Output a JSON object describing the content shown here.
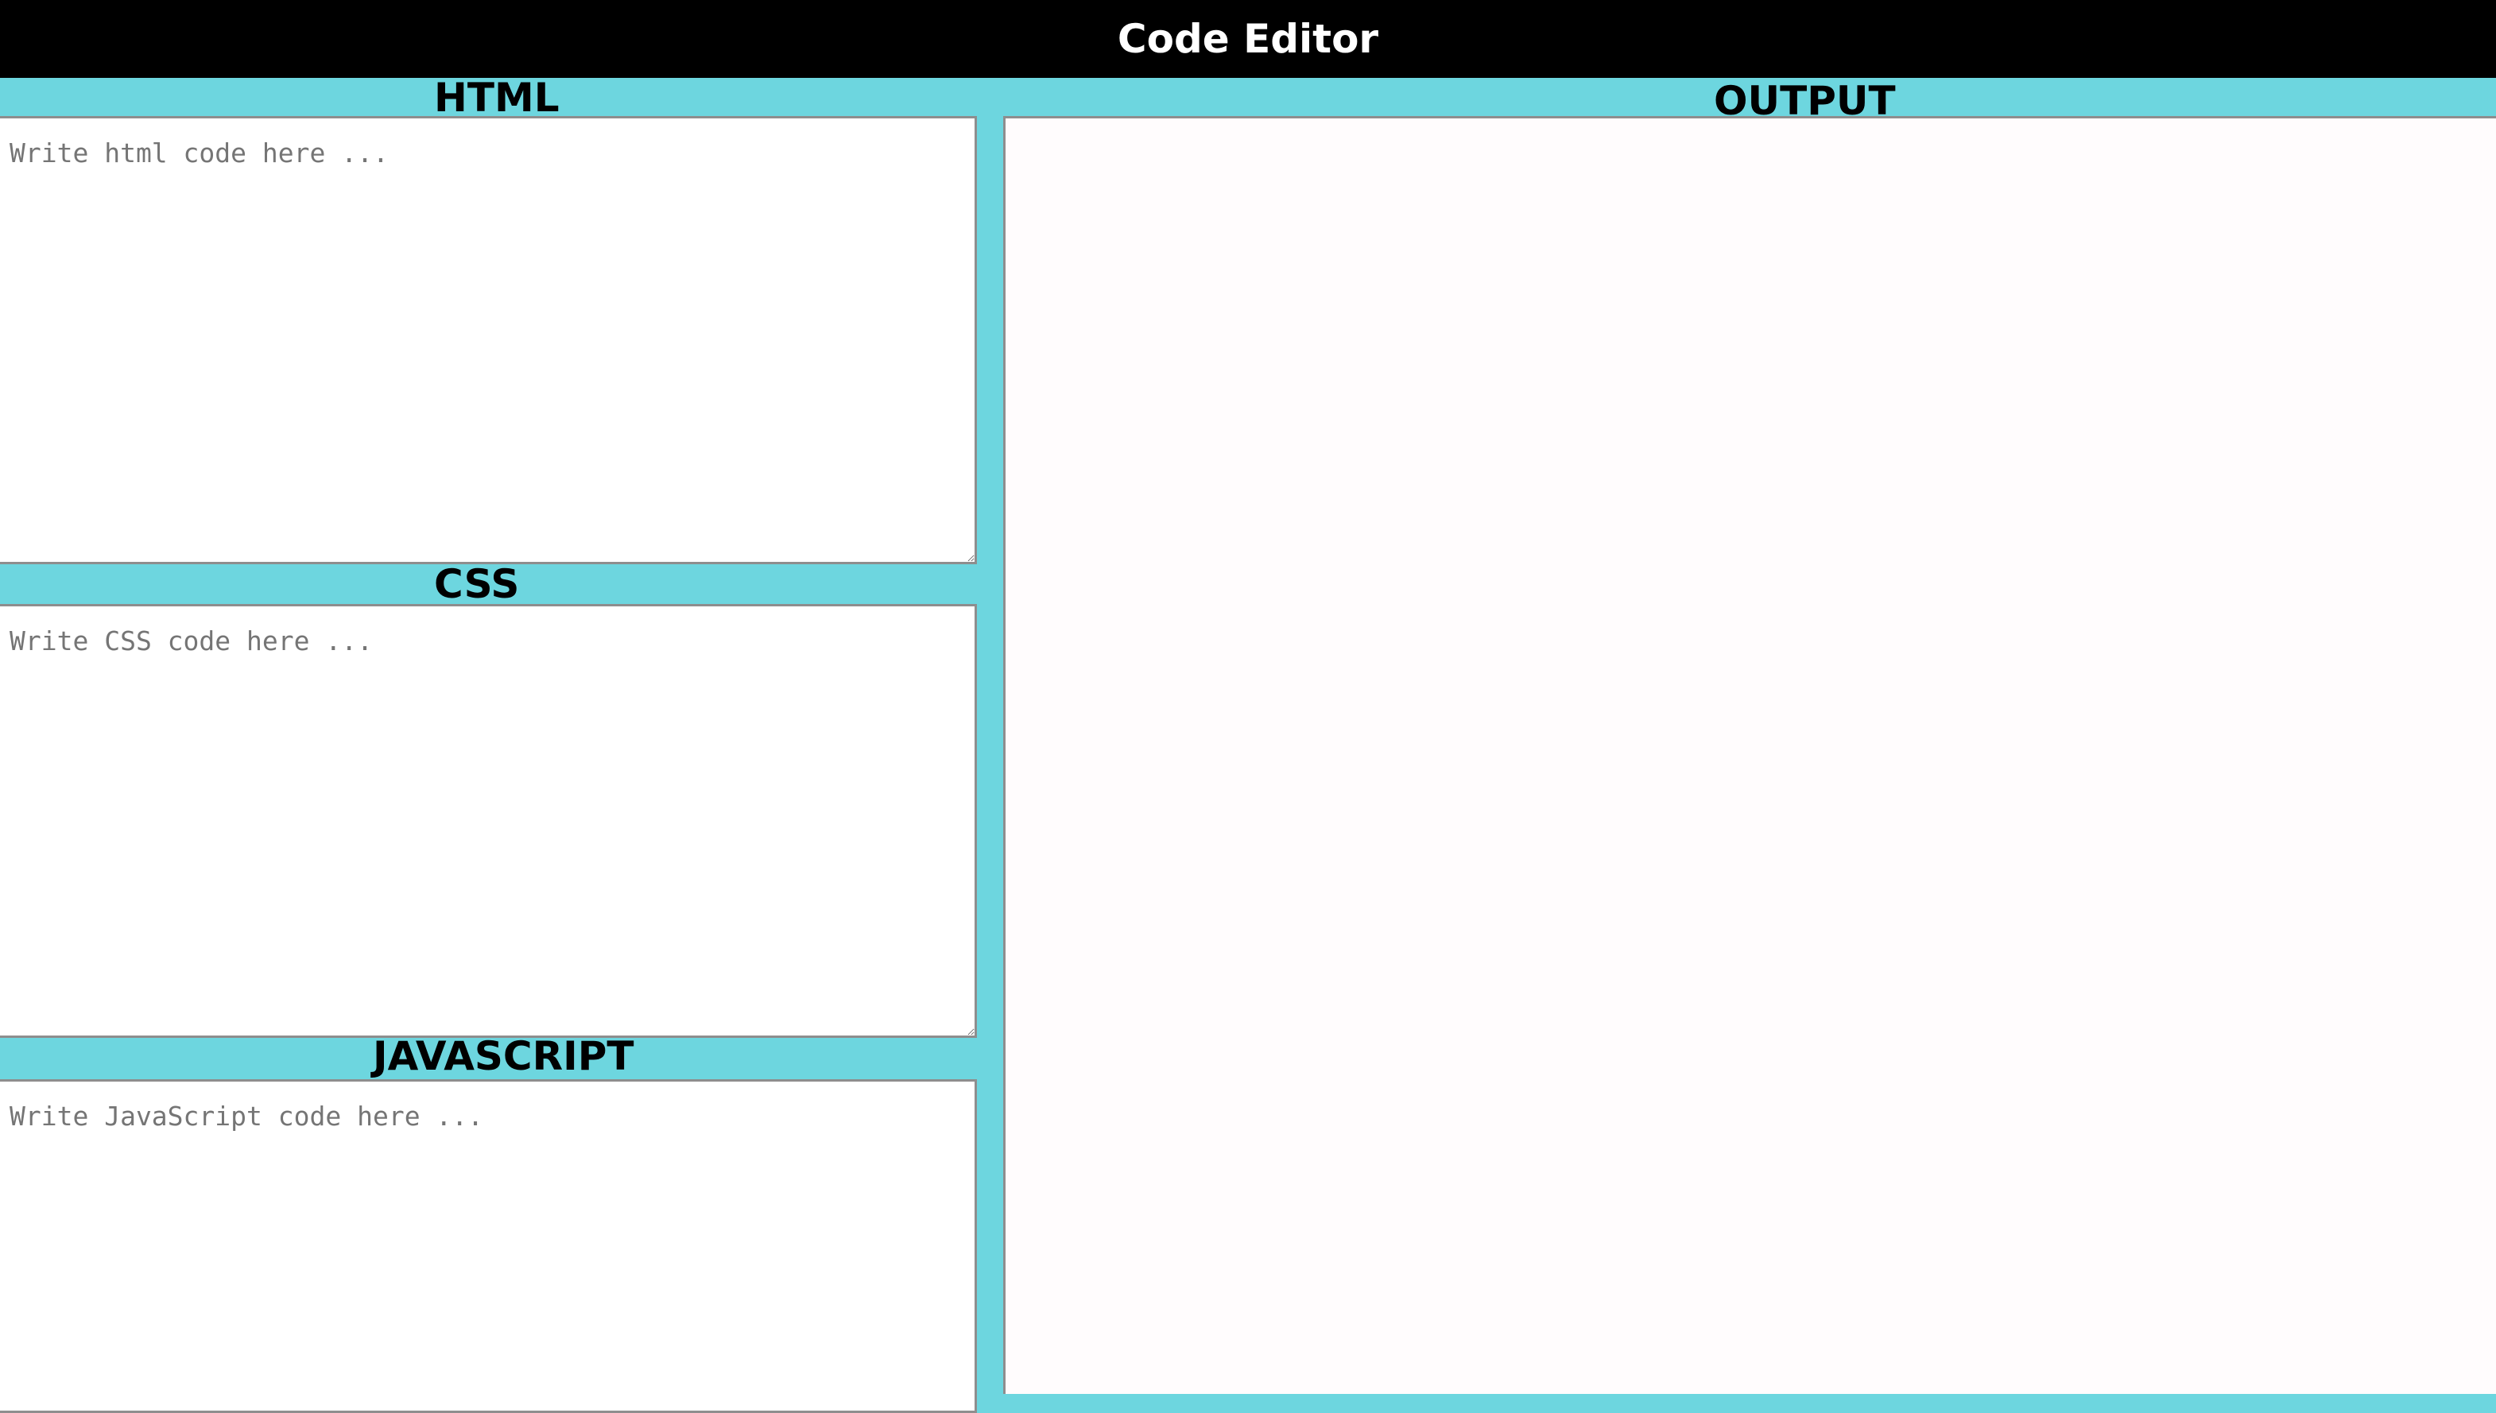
{
  "header": {
    "title": "Code Editor"
  },
  "panels": {
    "html": {
      "label": "HTML",
      "placeholder": "Write html code here ..."
    },
    "css": {
      "label": "CSS",
      "placeholder": "Write CSS code here ..."
    },
    "js": {
      "label": "JAVASCRIPT",
      "placeholder": "Write JavaScript code here ..."
    },
    "output": {
      "label": "OUTPUT"
    }
  },
  "colors": {
    "header_bg": "#000000",
    "header_text": "#ffffff",
    "panel_bg": "#6dd6df",
    "editor_bg": "#ffffff",
    "output_bg": "#fffcfd"
  }
}
